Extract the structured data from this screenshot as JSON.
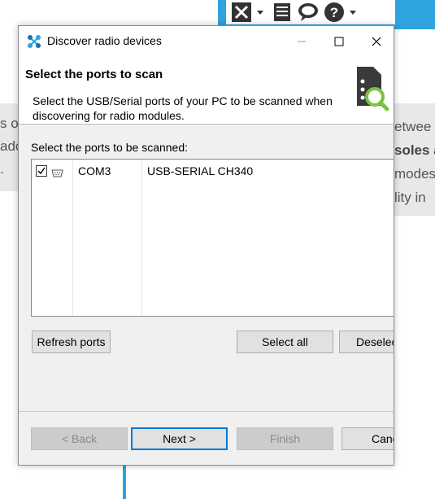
{
  "background": {
    "left_text": [
      "s o",
      "ado",
      "."
    ],
    "right_text": [
      "etwee",
      "soles a",
      "modes",
      "lity in"
    ],
    "toolbar_icons": [
      "tools-icon",
      "list-icon",
      "chat-icon",
      "help-icon"
    ]
  },
  "dialog": {
    "title": "Discover radio devices",
    "header_title": "Select the ports to scan",
    "header_description": "Select the USB/Serial ports of your PC to be scanned when discovering for radio modules.",
    "ports_label": "Select the ports to be scanned:",
    "ports": [
      {
        "checked": true,
        "name": "COM3",
        "description": "USB-SERIAL CH340"
      }
    ],
    "buttons": {
      "refresh": "Refresh ports",
      "select_all": "Select all",
      "deselect_all": "Deselect all",
      "back": "< Back",
      "next": "Next >",
      "finish": "Finish",
      "cancel": "Cancel"
    }
  },
  "colors": {
    "accent_blue": "#2ea3dc",
    "focus_blue": "#0078d7",
    "dialog_bg": "#f0f0f0"
  }
}
